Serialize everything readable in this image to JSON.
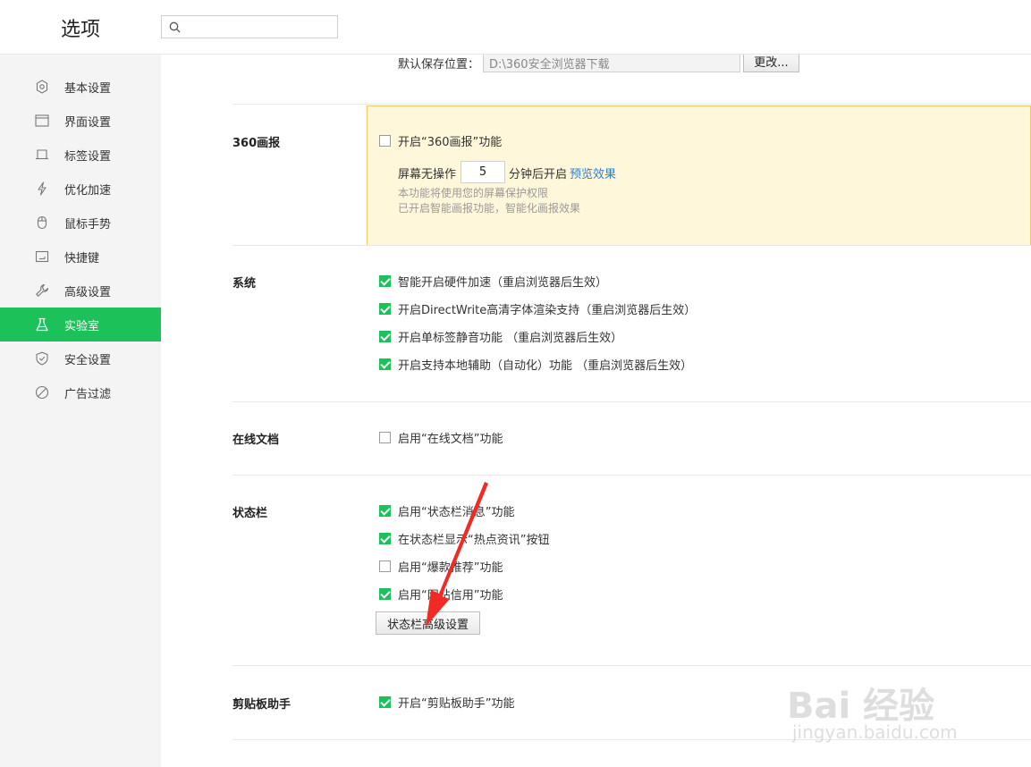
{
  "header": {
    "title": "选项",
    "search": {
      "value": "",
      "placeholder": "",
      "icon": "search-icon"
    }
  },
  "sidebar": {
    "active_color": "#1dc15a",
    "items": [
      {
        "label": "基本设置",
        "icon": "gear-icon",
        "active": false
      },
      {
        "label": "界面设置",
        "icon": "window-icon",
        "active": false
      },
      {
        "label": "标签设置",
        "icon": "tab-icon",
        "active": false
      },
      {
        "label": "优化加速",
        "icon": "lightning-icon",
        "active": false
      },
      {
        "label": "鼠标手势",
        "icon": "mouse-icon",
        "active": false
      },
      {
        "label": "快捷键",
        "icon": "keyboard-icon",
        "active": false
      },
      {
        "label": "高级设置",
        "icon": "wrench-icon",
        "active": false
      },
      {
        "label": "实验室",
        "icon": "flask-icon",
        "active": true
      },
      {
        "label": "安全设置",
        "icon": "shield-icon",
        "active": false
      },
      {
        "label": "广告过滤",
        "icon": "block-icon",
        "active": false
      }
    ]
  },
  "download": {
    "label": "默认保存位置：",
    "path": "D:\\360安全浏览器下载",
    "change_button": "更改..."
  },
  "huabao": {
    "title": "360画报",
    "enable_label": "开启“360画报”功能",
    "enable_checked": false,
    "idle_prefix": "屏幕无操作",
    "idle_minutes": "5",
    "idle_suffix": "分钟后开启",
    "preview_link": "预览效果",
    "note1": "本功能将使用您的屏幕保护权限",
    "note2": "已开启智能画报功能，智能化画报效果"
  },
  "system": {
    "title": "系统",
    "options": [
      {
        "label": "智能开启硬件加速（重启浏览器后生效）",
        "checked": true
      },
      {
        "label": "开启DirectWrite高清字体渲染支持（重启浏览器后生效）",
        "checked": true
      },
      {
        "label": "开启单标签静音功能 （重启浏览器后生效）",
        "checked": true
      },
      {
        "label": "开启支持本地辅助（自动化）功能 （重启浏览器后生效）",
        "checked": true
      }
    ]
  },
  "online_docs": {
    "title": "在线文档",
    "options": [
      {
        "label": "启用“在线文档”功能",
        "checked": false
      }
    ]
  },
  "statusbar": {
    "title": "状态栏",
    "options": [
      {
        "label": "启用“状态栏消息”功能",
        "checked": true
      },
      {
        "label": "在状态栏显示“热点资讯”按钮",
        "checked": true
      },
      {
        "label": "启用“爆款推荐”功能",
        "checked": false
      },
      {
        "label": "启用“网站信用”功能",
        "checked": true
      }
    ],
    "advanced_button": "状态栏高级设置"
  },
  "clipboard": {
    "title": "剪贴板助手",
    "options": [
      {
        "label": "开启“剪贴板助手”功能",
        "checked": true
      }
    ]
  },
  "watermark": {
    "brand": "Bai 经验",
    "site": "jingyan.baidu.com"
  }
}
